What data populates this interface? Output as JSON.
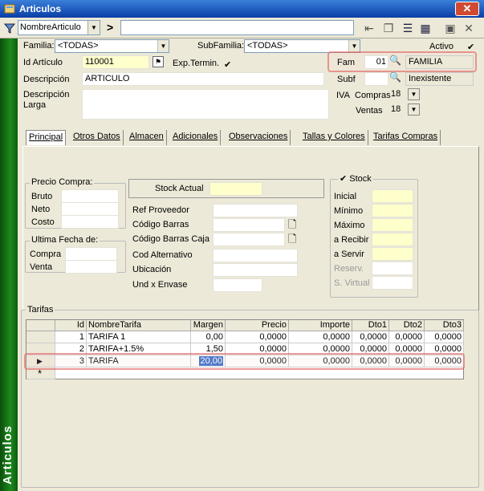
{
  "window": {
    "title": "Articulos",
    "close_icon": "close-icon"
  },
  "toolbar": {
    "selector_value": "NombreArticulo",
    "arrow": ">"
  },
  "sidebar": {
    "label": "Articulos"
  },
  "filters": {
    "familia_label": "Familia:",
    "familia_value": "<TODAS>",
    "subfamilia_label": "SubFamilia:",
    "subfamilia_value": "<TODAS>",
    "activo_label": "Activo"
  },
  "article": {
    "id_label": "Id Artículo",
    "id_value": "110001",
    "exp_label": "Exp.Termin.",
    "desc_label": "Descripción",
    "desc_value": "ARTICULO",
    "desc_larga_label": "Descripción Larga"
  },
  "fam": {
    "label": "Fam",
    "code": "01",
    "name": "FAMILIA",
    "subf_label": "Subf",
    "subf_name": "Inexistente"
  },
  "iva": {
    "label": "IVA",
    "compras_label": "Compras",
    "compras_value": "18",
    "ventas_label": "Ventas",
    "ventas_value": "18"
  },
  "tabs": [
    "Principal",
    "Otros Datos",
    "Almacen",
    "Adicionales",
    "Observaciones",
    "Tallas y Colores",
    "Tarifas Compras"
  ],
  "precio_compra": {
    "title": "Precio Compra:",
    "bruto": "Bruto",
    "neto": "Neto",
    "costo": "Costo"
  },
  "ultima_fecha": {
    "title": "Ultima Fecha de:",
    "compra": "Compra",
    "venta": "Venta"
  },
  "stock_actual": {
    "label": "Stock Actual"
  },
  "refs": {
    "ref_proveedor": "Ref Proveedor",
    "codigo_barras": "Código Barras",
    "codigo_barras_caja": "Código Barras Caja",
    "cod_alternativo": "Cod Alternativo",
    "ubicacion": "Ubicación",
    "und_envase": "Und x Envase"
  },
  "stock": {
    "title": "Stock",
    "inicial": "Inicial",
    "minimo": "Mínimo",
    "maximo": "Máximo",
    "a_recibir": "a Recibir",
    "a_servir": "a Servir",
    "reserv": "Reserv.",
    "virtual": "S. Virtual"
  },
  "tarifas": {
    "title": "Tarifas",
    "columns": [
      "Id",
      "NombreTarifa",
      "Margen",
      "Precio",
      "Importe",
      "Dto1",
      "Dto2",
      "Dto3"
    ],
    "rows": [
      {
        "id": "1",
        "nombre": "TARIFA 1",
        "margen": "0,00",
        "precio": "0,0000",
        "importe": "0,0000",
        "dto1": "0,0000",
        "dto2": "0,0000",
        "dto3": "0,0000"
      },
      {
        "id": "2",
        "nombre": "TARIFA+1.5%",
        "margen": "1,50",
        "precio": "0,0000",
        "importe": "0,0000",
        "dto1": "0,0000",
        "dto2": "0,0000",
        "dto3": "0,0000"
      },
      {
        "id": "3",
        "nombre": "TARIFA",
        "margen": "20,00",
        "precio": "0,0000",
        "importe": "0,0000",
        "dto1": "0,0000",
        "dto2": "0,0000",
        "dto3": "0,0000"
      }
    ],
    "new_row_marker": "*"
  }
}
